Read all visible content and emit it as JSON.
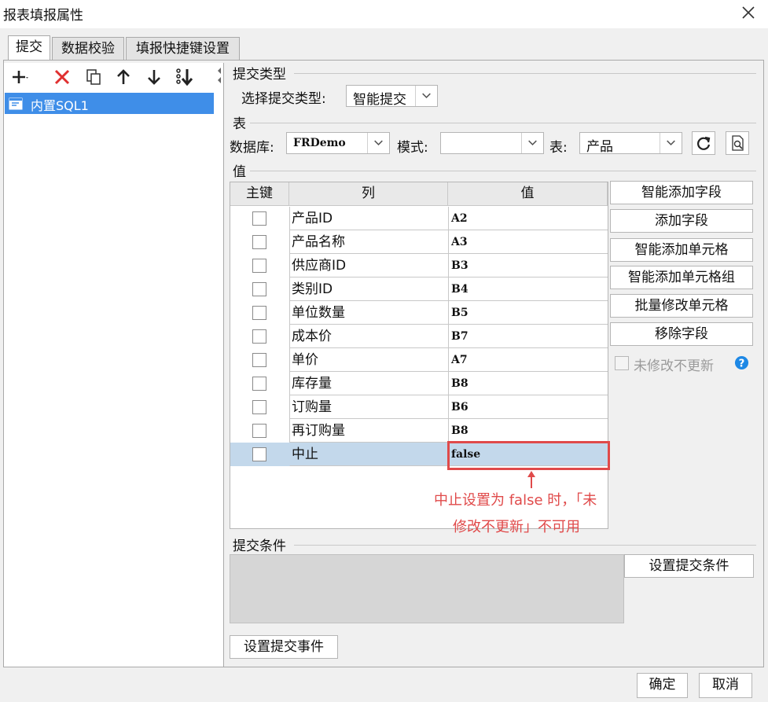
{
  "window": {
    "title": "报表填报属性"
  },
  "tabs": [
    "提交",
    "数据校验",
    "填报快捷键设置"
  ],
  "left_list": {
    "items": [
      "内置SQL1"
    ]
  },
  "submit_type": {
    "section_label": "提交类型",
    "label": "选择提交类型:",
    "value": "智能提交"
  },
  "table_section": {
    "section_label": "表",
    "db_label": "数据库:",
    "db_value": "FRDemo",
    "schema_label": "模式:",
    "schema_value": "",
    "table_label": "表:",
    "table_value": "产品"
  },
  "values_section": {
    "section_label": "值",
    "headers": {
      "key": "主键",
      "column": "列",
      "value": "值"
    },
    "rows": [
      {
        "column": "产品ID",
        "value": "A2"
      },
      {
        "column": "产品名称",
        "value": "A3"
      },
      {
        "column": "供应商ID",
        "value": "B3"
      },
      {
        "column": "类别ID",
        "value": "B4"
      },
      {
        "column": "单位数量",
        "value": "B5"
      },
      {
        "column": "成本价",
        "value": "B7"
      },
      {
        "column": "单价",
        "value": "A7"
      },
      {
        "column": "库存量",
        "value": "B8"
      },
      {
        "column": "订购量",
        "value": "B6"
      },
      {
        "column": "再订购量",
        "value": "B8"
      },
      {
        "column": "中止",
        "value": "false"
      }
    ],
    "selected_row": 10
  },
  "side_buttons": [
    "智能添加字段",
    "添加字段",
    "智能添加单元格",
    "智能添加单元格组",
    "批量修改单元格",
    "移除字段"
  ],
  "not_update_checkbox": {
    "label": "未修改不更新",
    "checked": false
  },
  "annotation": {
    "line1": "中止设置为 false 时，「未",
    "line2": "修改不更新」不可用"
  },
  "submit_condition": {
    "section_label": "提交条件",
    "button": "设置提交条件"
  },
  "submit_event_button": "设置提交事件",
  "footer": {
    "ok": "确定",
    "cancel": "取消"
  },
  "colors": {
    "accent": "#3f8ee8",
    "annotation": "#e04a4a",
    "selected_row": "#c3d8eb",
    "help": "#1e88e5"
  }
}
